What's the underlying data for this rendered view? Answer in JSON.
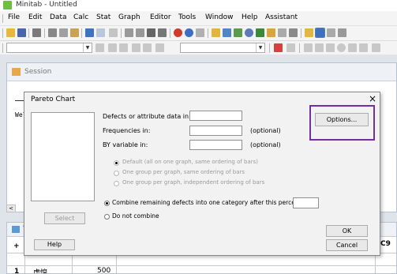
{
  "window": {
    "title": "Minitab - Untitled"
  },
  "menu": [
    "File",
    "Edit",
    "Data",
    "Calc",
    "Stat",
    "Graph",
    "Editor",
    "Tools",
    "Window",
    "Help",
    "Assistant"
  ],
  "session": {
    "title": "Session",
    "text": "Welc"
  },
  "worksheet": {
    "title": "W",
    "row_marker": "+",
    "row_number": "1",
    "cell_c1": "虚惶",
    "cell_c2": "500",
    "col_last": "C9"
  },
  "dialog": {
    "title": "Pareto Chart",
    "close": "×",
    "defects_label": "Defects or attribute data in:",
    "freq_label": "Frequencies in:",
    "freq_optional": "(optional)",
    "by_label": "BY variable in:",
    "by_optional": "(optional)",
    "options_button": "Options...",
    "group_options": [
      "Default (all on one graph, same ordering of bars)",
      "One group per graph, same ordering of bars",
      "One group per graph, independent ordering of bars"
    ],
    "combine_label": "Combine remaining defects into one category after this percent:",
    "do_not_combine": "Do not combine",
    "select_button": "Select",
    "help_button": "Help",
    "ok_button": "OK",
    "cancel_button": "Cancel"
  },
  "colors": {
    "highlight": "#7030a0",
    "app_icon": "#6fbf3f"
  }
}
